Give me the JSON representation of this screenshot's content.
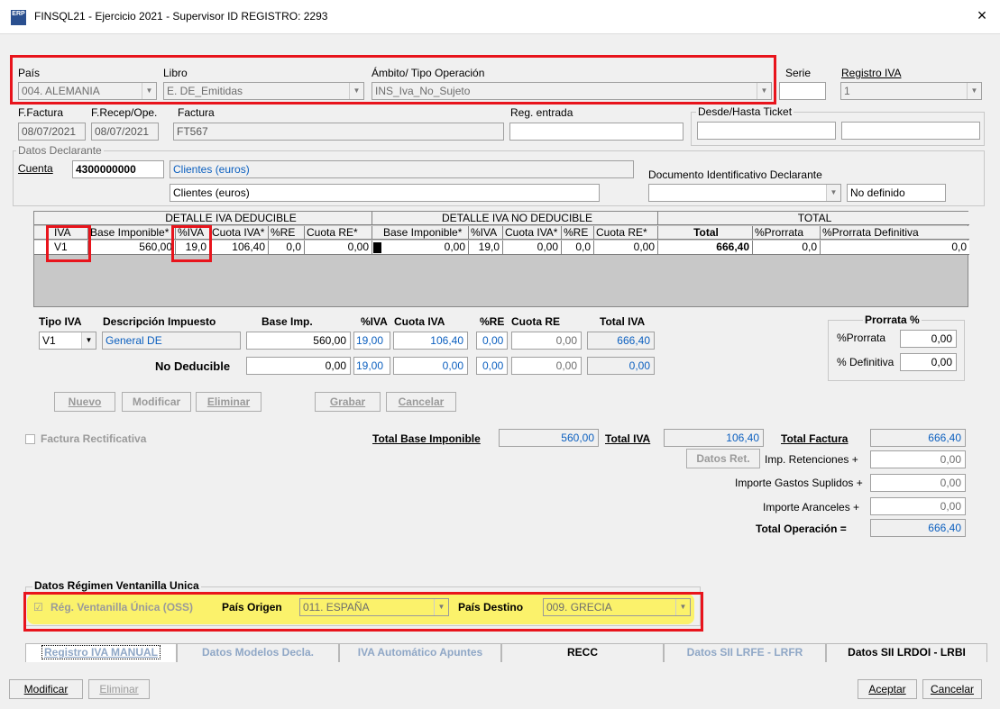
{
  "window": {
    "title": "FINSQL21 - Ejercicio 2021 - Supervisor ID REGISTRO: 2293",
    "close": "×",
    "logo": "ERP"
  },
  "header": {
    "pais_label": "País",
    "pais_value": "004.  ALEMANIA",
    "libro_label": "Libro",
    "libro_value": "E. DE_Emitidas",
    "ambito_label": "Ámbito/ Tipo Operación",
    "ambito_value": "INS_Iva_No_Sujeto",
    "serie_label": "Serie",
    "serie_value": "",
    "registro_label": "Registro IVA",
    "registro_value": "1"
  },
  "fechas": {
    "ffactura_label": "F.Factura",
    "ffactura_value": "08/07/2021",
    "frecep_label": "F.Recep/Ope.",
    "frecep_value": "08/07/2021",
    "factura_label": "Factura",
    "factura_value": "FT567",
    "regentrada_label": "Reg. entrada",
    "regentrada_value": "",
    "ticket_label": "Desde/Hasta Ticket"
  },
  "declarante": {
    "group_label": "Datos Declarante",
    "cuenta_label": "Cuenta",
    "cuenta_value": "4300000000",
    "nombre1": "Clientes (euros)",
    "nombre2": "Clientes (euros)",
    "doc_label": "Documento Identificativo Declarante",
    "doc_value": "",
    "doc_status": "No definido"
  },
  "grid": {
    "sec_deducible": "DETALLE IVA DEDUCIBLE",
    "sec_nodeducible": "DETALLE IVA NO DEDUCIBLE",
    "sec_total": "TOTAL",
    "cols": {
      "iva": "IVA",
      "base": "Base Imponible*",
      "piva": "%IVA",
      "cuota": "Cuota IVA*",
      "pre": "%RE",
      "cuotare": "Cuota RE*",
      "nbase": "Base Imponible*",
      "npiva": "%IVA",
      "ncuota": "Cuota IVA*",
      "npre": "%RE",
      "ncuotare": "Cuota RE*",
      "total": "Total",
      "prorrata": "%Prorrata",
      "prorratadef": "%Prorrata Definitiva"
    },
    "row": {
      "iva": "V1",
      "base": "560,00",
      "piva": "19,0",
      "cuota": "106,40",
      "pre": "0,0",
      "cuotare": "0,00",
      "nbase": "0,00",
      "npiva": "19,0",
      "ncuota": "0,00",
      "npre": "0,0",
      "ncuotare": "0,00",
      "total": "666,40",
      "prorrata": "0,0",
      "prorratadef": "0,0"
    }
  },
  "detalle": {
    "tipo_label": "Tipo IVA",
    "desc_label": "Descripción Impuesto",
    "base_label": "Base Imp.",
    "piva_label": "%IVA",
    "cuota_label": "Cuota IVA",
    "pre_label": "%RE",
    "cuotare_label": "Cuota RE",
    "total_label": "Total IVA",
    "tipo_value": "V1",
    "desc_value": "General DE",
    "base1": "560,00",
    "piva1": "19,00",
    "cuota1": "106,40",
    "pre1": "0,00",
    "cuotare1": "0,00",
    "total1": "666,40",
    "nodeducible_label": "No  Deducible",
    "base2": "0,00",
    "piva2": "19,00",
    "cuota2": "0,00",
    "pre2": "0,00",
    "cuotare2": "0,00",
    "total2": "0,00",
    "prorrata_group": "Prorrata %",
    "prorrata_label": "%Prorrata",
    "prorrata_value": "0,00",
    "definitiva_label": "% Definitiva",
    "definitiva_value": "0,00"
  },
  "actions": {
    "nuevo": "Nuevo",
    "modificar": "Modificar",
    "eliminar": "Eliminar",
    "grabar": "Grabar",
    "cancelar": "Cancelar"
  },
  "totales": {
    "rectificativa": "Factura Rectificativa",
    "base_label": "Total Base Imponible",
    "base_value": "560,00",
    "iva_label": "Total IVA",
    "iva_value": "106,40",
    "factura_label": "Total Factura",
    "factura_value": "666,40",
    "datosret": "Datos Ret.",
    "retenciones_label": "Imp. Retenciones +",
    "retenciones_value": "0,00",
    "suplidos_label": "Importe Gastos Suplidos +",
    "suplidos_value": "0,00",
    "aranceles_label": "Importe Aranceles +",
    "aranceles_value": "0,00",
    "operacion_label": "Total Operación =",
    "operacion_value": "666,40"
  },
  "oss": {
    "group_label": "Datos Régimen Ventanilla Unica",
    "check_label": "Rég. Ventanilla Única (OSS)",
    "origen_label": "País Origen",
    "origen_value": "011.  ESPAÑA",
    "destino_label": "País Destino",
    "destino_value": "009.  GRECIA"
  },
  "tabs": [
    "Registro IVA MANUAL",
    "Datos Modelos Decla.",
    "IVA Automático Apuntes",
    "RECC",
    "Datos SII  LRFE - LRFR",
    "Datos SII  LRDOI - LRBI"
  ],
  "footer": {
    "modificar": "Modificar",
    "eliminar": "Eliminar",
    "aceptar": "Aceptar",
    "cancelar": "Cancelar"
  }
}
